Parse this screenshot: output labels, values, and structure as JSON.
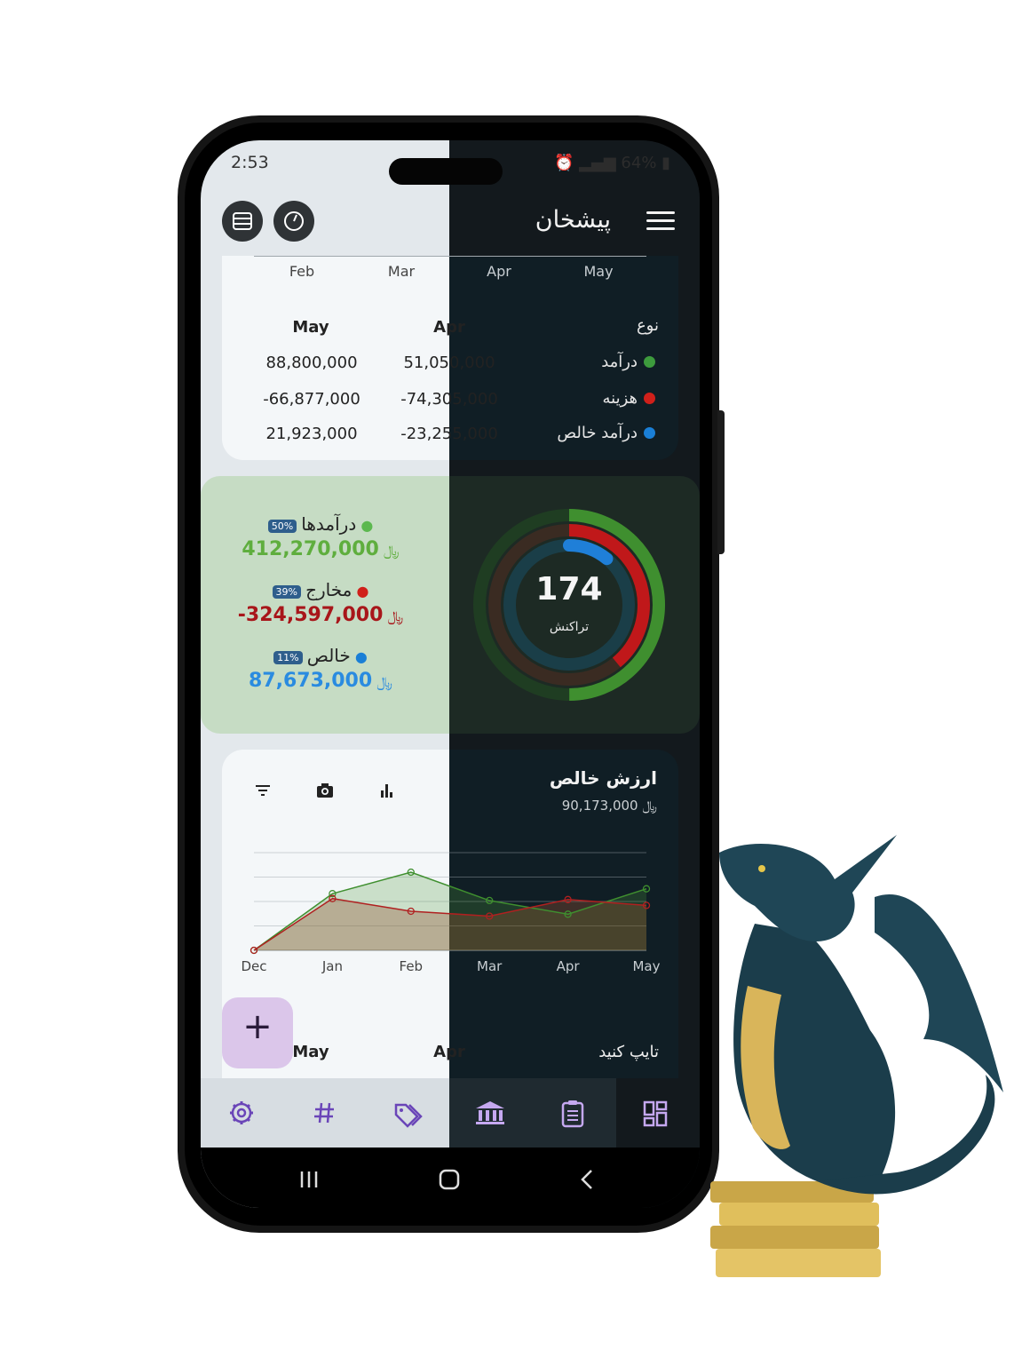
{
  "status_bar": {
    "time": "2:53",
    "battery": "64%"
  },
  "app_bar": {
    "title": "پیشخان"
  },
  "monthly_chart_top": {
    "months": [
      "Feb",
      "Mar",
      "Apr",
      "May"
    ]
  },
  "summary_table": {
    "headers": [
      "May",
      "Apr",
      "نوع"
    ],
    "rows": [
      {
        "may": "88,800,000",
        "apr": "51,050,000",
        "label": "درآمد",
        "color": "#3d9b3d"
      },
      {
        "may": "-66,877,000",
        "apr": "-74,305,000",
        "label": "هزینه",
        "color": "#d0201a"
      },
      {
        "may": "21,923,000",
        "apr": "-23,255,000",
        "label": "درآمد خالص",
        "color": "#1a7fd6"
      }
    ]
  },
  "overview": {
    "income": {
      "label": "درآمدها",
      "percent": "50%",
      "value": "412,270,000",
      "currency": "﷼",
      "color": "#5fae3e"
    },
    "expense": {
      "label": "مخارج",
      "percent": "39%",
      "value": "-324,597,000",
      "currency": "﷼",
      "color": "#a8161a"
    },
    "net": {
      "label": "خالص",
      "percent": "11%",
      "value": "87,673,000",
      "currency": "﷼",
      "color": "#2a8be0"
    },
    "transactions_count": "174",
    "transactions_label": "تراکنش"
  },
  "net_worth": {
    "title": "ارزش خالص",
    "value": "90,173,000",
    "currency": "﷼",
    "toolbar": {
      "filter_icon": "filter-icon",
      "camera_icon": "camera-icon",
      "chart_icon": "bar-chart-icon"
    }
  },
  "chart_data": {
    "type": "line",
    "categories": [
      "Dec",
      "Jan",
      "Feb",
      "Mar",
      "Apr",
      "May"
    ],
    "series": [
      {
        "values": [
          0,
          58,
          80,
          51,
          37,
          63
        ],
        "color": "#3f8f2f"
      },
      {
        "values": [
          0,
          53,
          40,
          35,
          52,
          46
        ],
        "color": "#b02020"
      }
    ],
    "ylim": [
      0,
      100
    ],
    "grid": true
  },
  "table_bottom": {
    "headers": [
      "May",
      "Apr",
      "تایپ کنید"
    ]
  },
  "fab": {
    "label": "+"
  },
  "bottom_nav": {
    "items": [
      {
        "name": "settings",
        "icon": "gear-icon"
      },
      {
        "name": "hashtags",
        "icon": "hash-icon"
      },
      {
        "name": "tags",
        "icon": "tags-icon"
      },
      {
        "name": "accounts",
        "icon": "bank-icon"
      },
      {
        "name": "budgets",
        "icon": "clipboard-icon"
      },
      {
        "name": "dashboard",
        "icon": "dashboard-icon"
      }
    ]
  }
}
